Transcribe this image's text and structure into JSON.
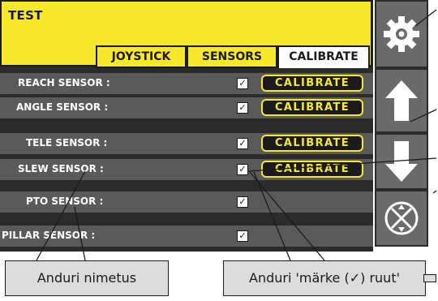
{
  "header": {
    "title": "TEST"
  },
  "tabs": [
    {
      "label": "JOYSTICK",
      "active": false
    },
    {
      "label": "SENSORS",
      "active": false
    },
    {
      "label": "CALIBRATE",
      "active": true
    }
  ],
  "rows": [
    {
      "label": "REACH SENSOR :",
      "checked": true,
      "button": "CALIBRATE"
    },
    {
      "label": "ANGLE SENSOR :",
      "checked": true,
      "button": "CALIBRATE"
    },
    {
      "label": "TELE SENSOR :",
      "checked": true,
      "button": "CALIBRATE"
    },
    {
      "label": "SLEW SENSOR :",
      "checked": true,
      "button": "CALIBRATE"
    },
    {
      "label": "PTO SENSOR :",
      "checked": true,
      "button": ""
    },
    {
      "label": "PILLAR SENSOR :",
      "checked": true,
      "button": ""
    }
  ],
  "checkmark": "✓",
  "side_buttons": [
    "gear-icon",
    "arrow-up-icon",
    "arrow-down-icon",
    "exit-circle-icon"
  ],
  "callouts": {
    "sensor_name": "Anduri nimetus",
    "checkbox": "Anduri 'märke (✓) ruut'"
  },
  "colors": {
    "accent": "#f7e82c",
    "background": "#2b2b2b",
    "row": "#5a5a5a",
    "side": "#6a6a6a"
  }
}
